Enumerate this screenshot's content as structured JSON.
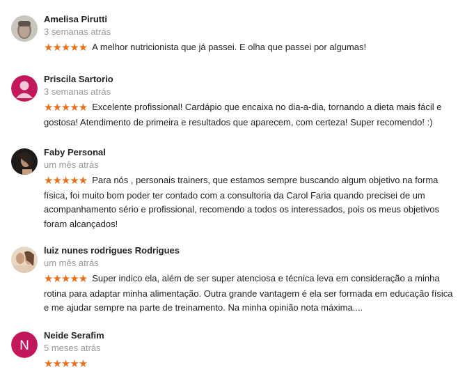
{
  "colors": {
    "star": "#e7711b",
    "date": "#999999",
    "avatar_magenta": "#c2185b"
  },
  "reviews": [
    {
      "name": "Amelisa Pirutti",
      "date": "3 semanas atrás",
      "rating": 5,
      "stars": "★★★★★",
      "avatar": "photo",
      "text": "A melhor nutricionista que já passei. E olha que passei por algumas!"
    },
    {
      "name": "Priscila Sartorio",
      "date": "3 semanas atrás",
      "rating": 5,
      "stars": "★★★★★",
      "avatar": "person-icon",
      "text": "Excelente profissional! Cardápio que encaixa no dia-a-dia, tornando a dieta mais fácil e gostosa! Atendimento de primeira e resultados que aparecem, com certeza! Super recomendo! :)"
    },
    {
      "name": "Faby Personal",
      "date": "um mês atrás",
      "rating": 5,
      "stars": "★★★★★",
      "avatar": "photo",
      "text": "Para nós , personais trainers, que  estamos sempre buscando algum objetivo na forma física, foi muito bom poder ter contado com a consultoria da Carol Faria quando precisei de um acompanhamento sério e profissional, recomendo a todos os interessados, pois os meus objetivos foram alcançados!"
    },
    {
      "name": "luiz nunes rodrigues Rodrigues",
      "date": "um mês atrás",
      "rating": 5,
      "stars": "★★★★★",
      "avatar": "photo",
      "text": "Super indico ela, além de ser super atenciosa e técnica leva em consideração a minha rotina para adaptar  minha alimentação. Outra grande vantagem é ela ser formada em educação física e me ajudar sempre na parte de treinamento. Na minha opinião nota máxima...."
    },
    {
      "name": "Neide Serafim",
      "date": "5 meses atrás",
      "rating": 5,
      "stars": "★★★★★",
      "avatar": "letter",
      "avatar_letter": "N",
      "text": ""
    }
  ]
}
